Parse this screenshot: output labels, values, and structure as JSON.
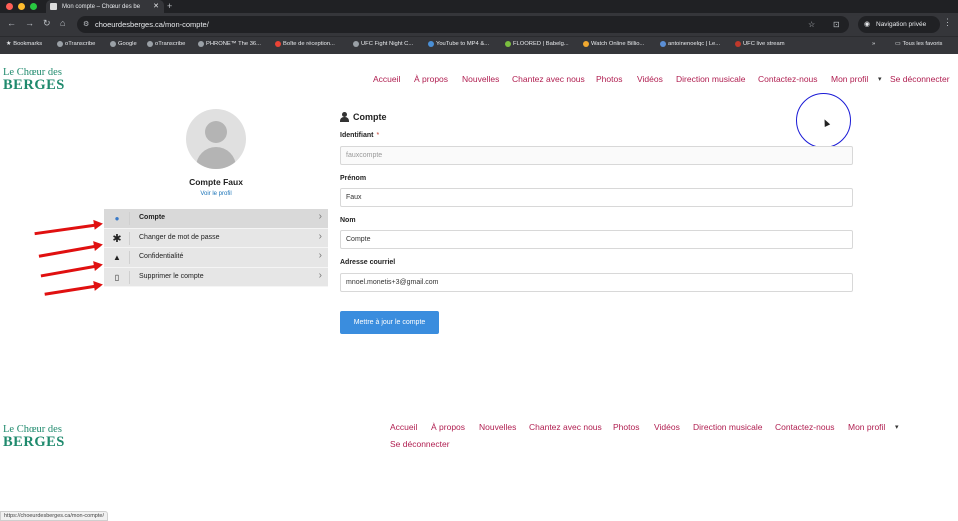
{
  "browser": {
    "tab_title": "Mon compte – Chœur des be",
    "url": "choeurdesberges.ca/mon-compte/",
    "private_label": "Navigation privée",
    "status_url": "https://choeurdesberges.ca/mon-compte/",
    "bookmarks": [
      "Bookmarks",
      "oTranscribe",
      "Google",
      "oTranscribe",
      "PHRONE™ The 36...",
      "Boîte de réception...",
      "UFC Fight Night C...",
      "YouTube to MP4 &...",
      "FLOORED | Babelg...",
      "Watch Online Billio...",
      "antoinenoelqc | Le...",
      "UFC live stream"
    ],
    "all_bookmarks": "Tous les favoris"
  },
  "site": {
    "logo_line1": "Le Chœur des",
    "logo_line2": "BERGES",
    "nav": [
      "Accueil",
      "À propos",
      "Nouvelles",
      "Chantez avec nous",
      "Photos",
      "Vidéos",
      "Direction musicale",
      "Contactez-nous",
      "Mon profil",
      "Se déconnecter"
    ],
    "dropdown_caret": "▾"
  },
  "profile": {
    "name": "Compte Faux",
    "view_profile": "Voir le profil",
    "menu": [
      {
        "label": "Compte",
        "icon": "user-icon"
      },
      {
        "label": "Changer de mot de passe",
        "icon": "asterisk-icon"
      },
      {
        "label": "Confidentialité",
        "icon": "lock-icon"
      },
      {
        "label": "Supprimer le compte",
        "icon": "trash-icon"
      }
    ]
  },
  "form": {
    "title": "Compte",
    "username_label": "Identifiant",
    "username_required": "*",
    "username_value": "fauxcompte",
    "firstname_label": "Prénom",
    "firstname_value": "Faux",
    "lastname_label": "Nom",
    "lastname_value": "Compte",
    "email_label": "Adresse courriel",
    "email_value": "mnoel.monetis+3@gmail.com",
    "submit_label": "Mettre à jour le compte"
  },
  "footer": {
    "nav": [
      "Accueil",
      "À propos",
      "Nouvelles",
      "Chantez avec nous",
      "Photos",
      "Vidéos",
      "Direction musicale",
      "Contactez-nous",
      "Mon profil",
      "Se déconnecter"
    ]
  },
  "colors": {
    "accent": "#b01e50",
    "brand": "#1f8a6d",
    "button": "#3a8dde",
    "annotation": "#e01010"
  }
}
